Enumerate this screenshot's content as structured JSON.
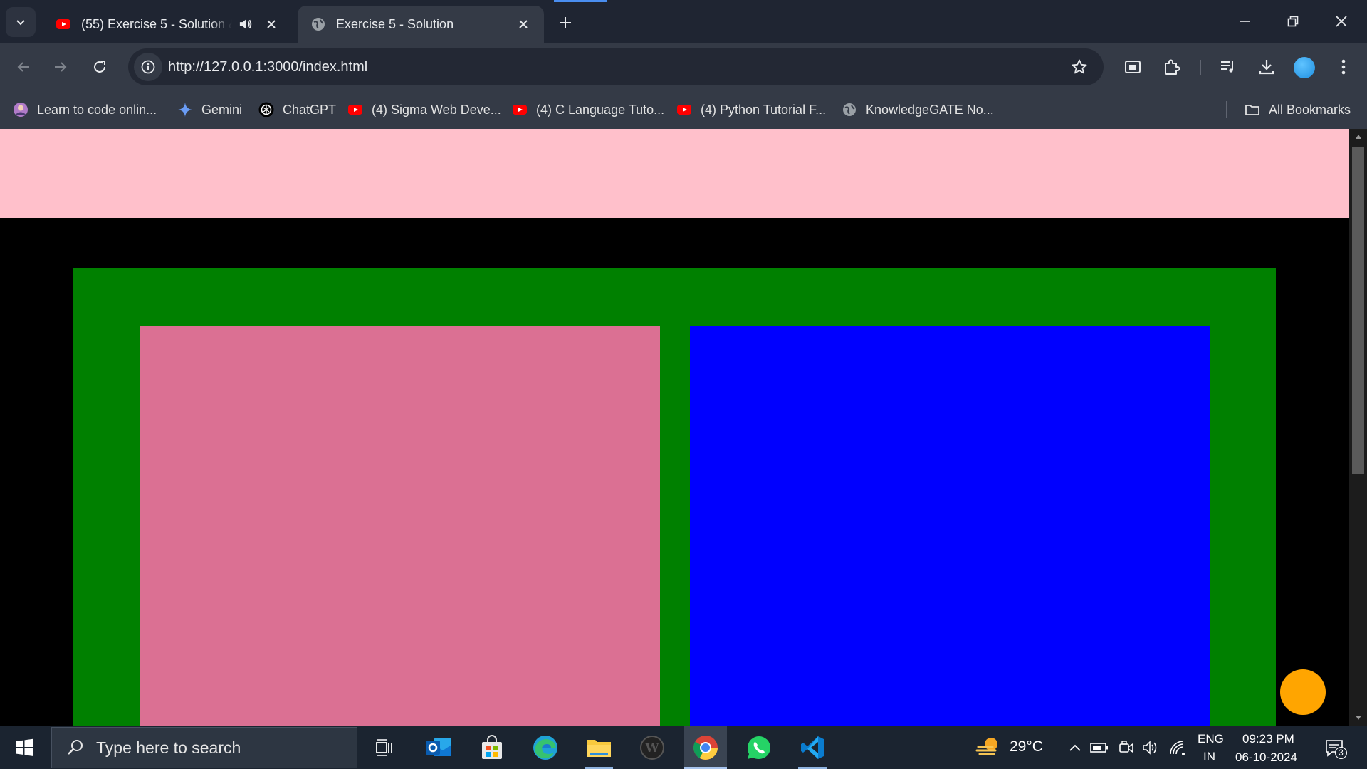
{
  "browser": {
    "tabs": [
      {
        "title": "(55) Exercise 5 - Solution & ",
        "favicon": "youtube-icon",
        "audio": true,
        "active": false
      },
      {
        "title": "Exercise 5 - Solution",
        "favicon": "globe-icon",
        "active": true
      }
    ],
    "address_bar": {
      "url": "http://127.0.0.1:3000/index.html"
    },
    "bookmarks": [
      {
        "label": "Learn to code onlin...",
        "icon": "avatar-icon"
      },
      {
        "label": "Gemini",
        "icon": "gemini-icon"
      },
      {
        "label": "ChatGPT",
        "icon": "chatgpt-icon"
      },
      {
        "label": "(4) Sigma Web Deve...",
        "icon": "youtube-icon"
      },
      {
        "label": "(4) C Language Tuto...",
        "icon": "youtube-icon"
      },
      {
        "label": "(4) Python Tutorial F...",
        "icon": "youtube-icon"
      },
      {
        "label": "KnowledgeGATE No...",
        "icon": "globe-icon"
      }
    ],
    "all_bookmarks_label": "All Bookmarks"
  },
  "page": {
    "colors": {
      "background": "#000000",
      "top_bar": "#ffc0cb",
      "container": "#008000",
      "left_box": "#db7093",
      "right_box": "#0000ff",
      "circle": "#ffa500"
    }
  },
  "taskbar": {
    "search_placeholder": "Type here to search",
    "apps": [
      "task-view-icon",
      "outlook-icon",
      "microsoft-store-icon",
      "edge-icon",
      "file-explorer-icon",
      "wordpress-icon",
      "chrome-icon",
      "whatsapp-icon",
      "vscode-icon"
    ],
    "weather": {
      "temperature": "29°C"
    },
    "language": {
      "line1": "ENG",
      "line2": "IN"
    },
    "clock": {
      "time": "09:23 PM",
      "date": "06-10-2024"
    },
    "notifications": {
      "count": "3"
    }
  }
}
